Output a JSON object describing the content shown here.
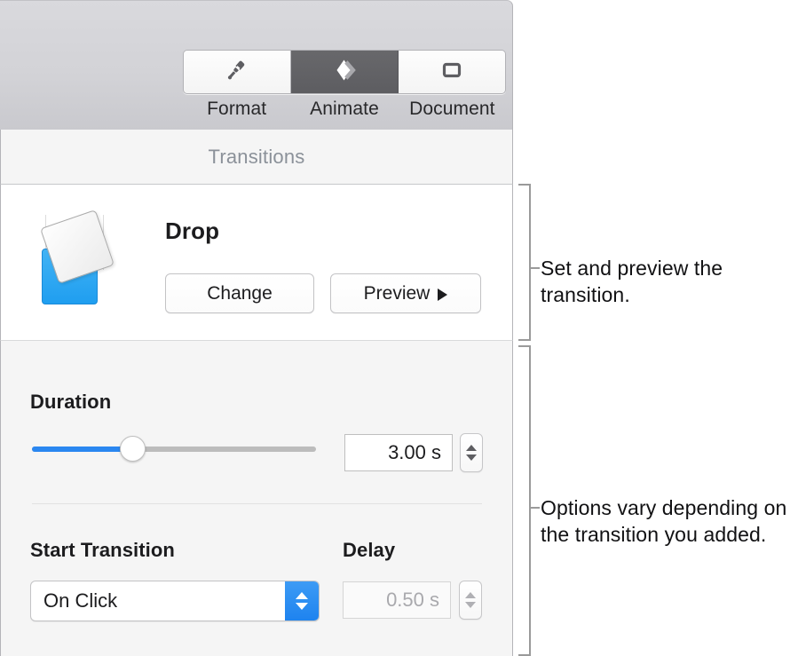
{
  "inspector": {
    "tabs": [
      {
        "label": "Format",
        "icon": "paint-brush-icon",
        "active": false
      },
      {
        "label": "Animate",
        "icon": "diamond-chevron-icon",
        "active": true
      },
      {
        "label": "Document",
        "icon": "document-square-icon",
        "active": false
      }
    ],
    "pane_title": "Transitions",
    "transition": {
      "name": "Drop",
      "thumbnail_icon": "drop-transition-thumbnail",
      "change_button": "Change",
      "preview_button": "Preview",
      "preview_icon": "play-triangle-icon"
    },
    "duration": {
      "label": "Duration",
      "value": "3.00 s",
      "slider_fill_percent": 36,
      "stepper_icon": "stepper-up-down-icon"
    },
    "start_transition": {
      "label": "Start Transition",
      "value": "On Click",
      "popup_icon": "popup-up-down-icon"
    },
    "delay": {
      "label": "Delay",
      "value": "0.50 s",
      "disabled": true,
      "stepper_icon": "stepper-up-down-icon"
    }
  },
  "callouts": [
    {
      "text": "Set and preview the transition."
    },
    {
      "text": "Options vary depending on the transition you added."
    }
  ],
  "colors": {
    "accent_blue": "#2a87f0",
    "popup_blue": "#1e83ef",
    "thumbnail_blue": "#1f9ef0",
    "active_tab_gray": "#5d5d61",
    "panel_gray": "#f5f5f5",
    "toolbar_gray": "#d3d3d7",
    "callout_line": "#9a9a9a"
  }
}
